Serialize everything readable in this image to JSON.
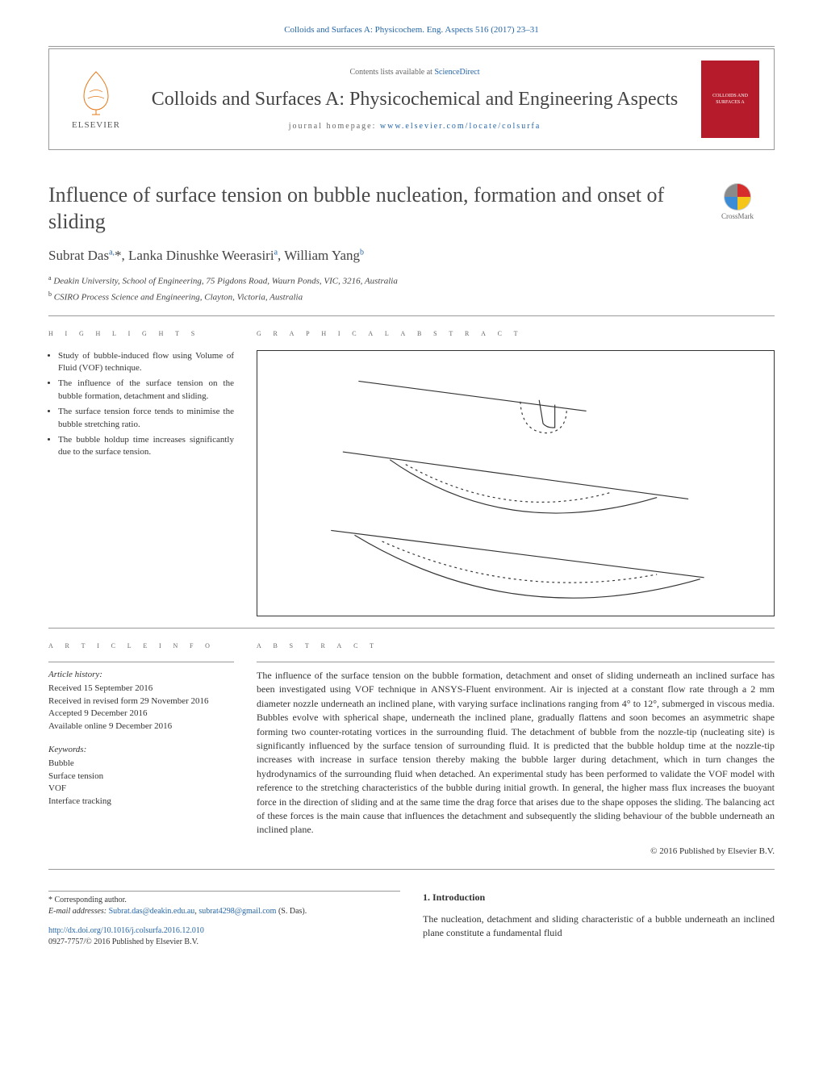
{
  "citation": "Colloids and Surfaces A: Physicochem. Eng. Aspects 516 (2017) 23–31",
  "header": {
    "contents_prefix": "Contents lists available at ",
    "contents_link": "ScienceDirect",
    "journal": "Colloids and Surfaces A: Physicochemical and Engineering Aspects",
    "homepage_prefix": "journal homepage: ",
    "homepage_link": "www.elsevier.com/locate/colsurfa",
    "publisher": "ELSEVIER"
  },
  "title": "Influence of surface tension on bubble nucleation, formation and onset of sliding",
  "crossmark_label": "CrossMark",
  "authors_html": "Subrat Das<sup>a,</sup>*, Lanka Dinushke Weerasiri<sup>a</sup>, William Yang<sup>b</sup>",
  "affiliations": [
    {
      "sup": "a",
      "text": "Deakin University, School of Engineering, 75 Pigdons Road, Waurn Ponds, VIC, 3216, Australia"
    },
    {
      "sup": "b",
      "text": "CSIRO Process Science and Engineering, Clayton, Victoria, Australia"
    }
  ],
  "labels": {
    "highlights": "h i g h l i g h t s",
    "graphical": "g r a p h i c a l  a b s t r a c t",
    "article_info": "a r t i c l e  i n f o",
    "abstract": "a b s t r a c t"
  },
  "highlights": [
    "Study of bubble-induced flow using Volume of Fluid (VOF) technique.",
    "The influence of the surface tension on the bubble formation, detachment and sliding.",
    "The surface tension force tends to minimise the bubble stretching ratio.",
    "The bubble holdup time increases significantly due to the surface tension."
  ],
  "article_info": {
    "history_label": "Article history:",
    "received": "Received 15 September 2016",
    "revised": "Received in revised form 29 November 2016",
    "accepted": "Accepted 9 December 2016",
    "online": "Available online 9 December 2016",
    "keywords_label": "Keywords:",
    "keywords": [
      "Bubble",
      "Surface tension",
      "VOF",
      "Interface tracking"
    ]
  },
  "abstract": "The influence of the surface tension on the bubble formation, detachment and onset of sliding underneath an inclined surface has been investigated using VOF technique in ANSYS-Fluent environment. Air is injected at a constant flow rate through a 2 mm diameter nozzle underneath an inclined plane, with varying surface inclinations ranging from 4° to 12°, submerged in viscous media. Bubbles evolve with spherical shape, underneath the inclined plane, gradually flattens and soon becomes an asymmetric shape forming two counter-rotating vortices in the surrounding fluid. The detachment of bubble from the nozzle-tip (nucleating site) is significantly influenced by the surface tension of surrounding fluid. It is predicted that the bubble holdup time at the nozzle-tip increases with increase in surface tension thereby making the bubble larger during detachment, which in turn changes the hydrodynamics of the surrounding fluid when detached. An experimental study has been performed to validate the VOF model with reference to the stretching characteristics of the bubble during initial growth. In general, the higher mass flux increases the buoyant force in the direction of sliding and at the same time the drag force that arises due to the shape opposes the sliding. The balancing act of these forces is the main cause that influences the detachment and subsequently the sliding behaviour of the bubble underneath an inclined plane.",
  "copyright": "© 2016 Published by Elsevier B.V.",
  "intro": {
    "heading": "1. Introduction",
    "text": "The nucleation, detachment and sliding characteristic of a bubble underneath an inclined plane constitute a fundamental fluid"
  },
  "footer": {
    "corresponding": "* Corresponding author.",
    "email_label": "E-mail addresses: ",
    "email1": "Subrat.das@deakin.edu.au",
    "email2": "subrat4298@gmail.com",
    "email_suffix": " (S. Das).",
    "doi_link": "http://dx.doi.org/10.1016/j.colsurfa.2016.12.010",
    "issn": "0927-7757/© 2016 Published by Elsevier B.V."
  }
}
